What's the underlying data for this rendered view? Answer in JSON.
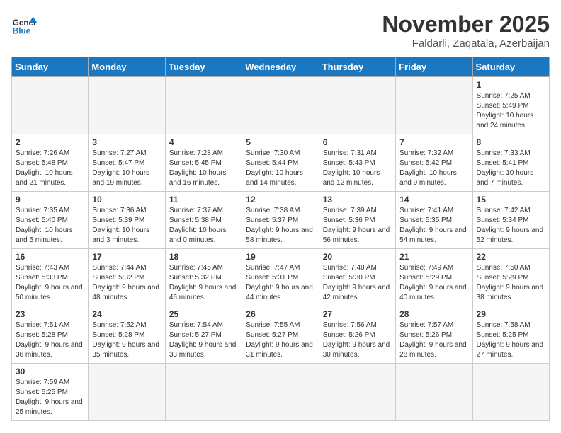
{
  "header": {
    "logo_general": "General",
    "logo_blue": "Blue",
    "month": "November 2025",
    "location": "Faldarli, Zaqatala, Azerbaijan"
  },
  "weekdays": [
    "Sunday",
    "Monday",
    "Tuesday",
    "Wednesday",
    "Thursday",
    "Friday",
    "Saturday"
  ],
  "weeks": [
    [
      {
        "day": "",
        "info": ""
      },
      {
        "day": "",
        "info": ""
      },
      {
        "day": "",
        "info": ""
      },
      {
        "day": "",
        "info": ""
      },
      {
        "day": "",
        "info": ""
      },
      {
        "day": "",
        "info": ""
      },
      {
        "day": "1",
        "info": "Sunrise: 7:25 AM\nSunset: 5:49 PM\nDaylight: 10 hours and 24 minutes."
      }
    ],
    [
      {
        "day": "2",
        "info": "Sunrise: 7:26 AM\nSunset: 5:48 PM\nDaylight: 10 hours and 21 minutes."
      },
      {
        "day": "3",
        "info": "Sunrise: 7:27 AM\nSunset: 5:47 PM\nDaylight: 10 hours and 19 minutes."
      },
      {
        "day": "4",
        "info": "Sunrise: 7:28 AM\nSunset: 5:45 PM\nDaylight: 10 hours and 16 minutes."
      },
      {
        "day": "5",
        "info": "Sunrise: 7:30 AM\nSunset: 5:44 PM\nDaylight: 10 hours and 14 minutes."
      },
      {
        "day": "6",
        "info": "Sunrise: 7:31 AM\nSunset: 5:43 PM\nDaylight: 10 hours and 12 minutes."
      },
      {
        "day": "7",
        "info": "Sunrise: 7:32 AM\nSunset: 5:42 PM\nDaylight: 10 hours and 9 minutes."
      },
      {
        "day": "8",
        "info": "Sunrise: 7:33 AM\nSunset: 5:41 PM\nDaylight: 10 hours and 7 minutes."
      }
    ],
    [
      {
        "day": "9",
        "info": "Sunrise: 7:35 AM\nSunset: 5:40 PM\nDaylight: 10 hours and 5 minutes."
      },
      {
        "day": "10",
        "info": "Sunrise: 7:36 AM\nSunset: 5:39 PM\nDaylight: 10 hours and 3 minutes."
      },
      {
        "day": "11",
        "info": "Sunrise: 7:37 AM\nSunset: 5:38 PM\nDaylight: 10 hours and 0 minutes."
      },
      {
        "day": "12",
        "info": "Sunrise: 7:38 AM\nSunset: 5:37 PM\nDaylight: 9 hours and 58 minutes."
      },
      {
        "day": "13",
        "info": "Sunrise: 7:39 AM\nSunset: 5:36 PM\nDaylight: 9 hours and 56 minutes."
      },
      {
        "day": "14",
        "info": "Sunrise: 7:41 AM\nSunset: 5:35 PM\nDaylight: 9 hours and 54 minutes."
      },
      {
        "day": "15",
        "info": "Sunrise: 7:42 AM\nSunset: 5:34 PM\nDaylight: 9 hours and 52 minutes."
      }
    ],
    [
      {
        "day": "16",
        "info": "Sunrise: 7:43 AM\nSunset: 5:33 PM\nDaylight: 9 hours and 50 minutes."
      },
      {
        "day": "17",
        "info": "Sunrise: 7:44 AM\nSunset: 5:32 PM\nDaylight: 9 hours and 48 minutes."
      },
      {
        "day": "18",
        "info": "Sunrise: 7:45 AM\nSunset: 5:32 PM\nDaylight: 9 hours and 46 minutes."
      },
      {
        "day": "19",
        "info": "Sunrise: 7:47 AM\nSunset: 5:31 PM\nDaylight: 9 hours and 44 minutes."
      },
      {
        "day": "20",
        "info": "Sunrise: 7:48 AM\nSunset: 5:30 PM\nDaylight: 9 hours and 42 minutes."
      },
      {
        "day": "21",
        "info": "Sunrise: 7:49 AM\nSunset: 5:29 PM\nDaylight: 9 hours and 40 minutes."
      },
      {
        "day": "22",
        "info": "Sunrise: 7:50 AM\nSunset: 5:29 PM\nDaylight: 9 hours and 38 minutes."
      }
    ],
    [
      {
        "day": "23",
        "info": "Sunrise: 7:51 AM\nSunset: 5:28 PM\nDaylight: 9 hours and 36 minutes."
      },
      {
        "day": "24",
        "info": "Sunrise: 7:52 AM\nSunset: 5:28 PM\nDaylight: 9 hours and 35 minutes."
      },
      {
        "day": "25",
        "info": "Sunrise: 7:54 AM\nSunset: 5:27 PM\nDaylight: 9 hours and 33 minutes."
      },
      {
        "day": "26",
        "info": "Sunrise: 7:55 AM\nSunset: 5:27 PM\nDaylight: 9 hours and 31 minutes."
      },
      {
        "day": "27",
        "info": "Sunrise: 7:56 AM\nSunset: 5:26 PM\nDaylight: 9 hours and 30 minutes."
      },
      {
        "day": "28",
        "info": "Sunrise: 7:57 AM\nSunset: 5:26 PM\nDaylight: 9 hours and 28 minutes."
      },
      {
        "day": "29",
        "info": "Sunrise: 7:58 AM\nSunset: 5:25 PM\nDaylight: 9 hours and 27 minutes."
      }
    ],
    [
      {
        "day": "30",
        "info": "Sunrise: 7:59 AM\nSunset: 5:25 PM\nDaylight: 9 hours and 25 minutes."
      },
      {
        "day": "",
        "info": ""
      },
      {
        "day": "",
        "info": ""
      },
      {
        "day": "",
        "info": ""
      },
      {
        "day": "",
        "info": ""
      },
      {
        "day": "",
        "info": ""
      },
      {
        "day": "",
        "info": ""
      }
    ]
  ]
}
